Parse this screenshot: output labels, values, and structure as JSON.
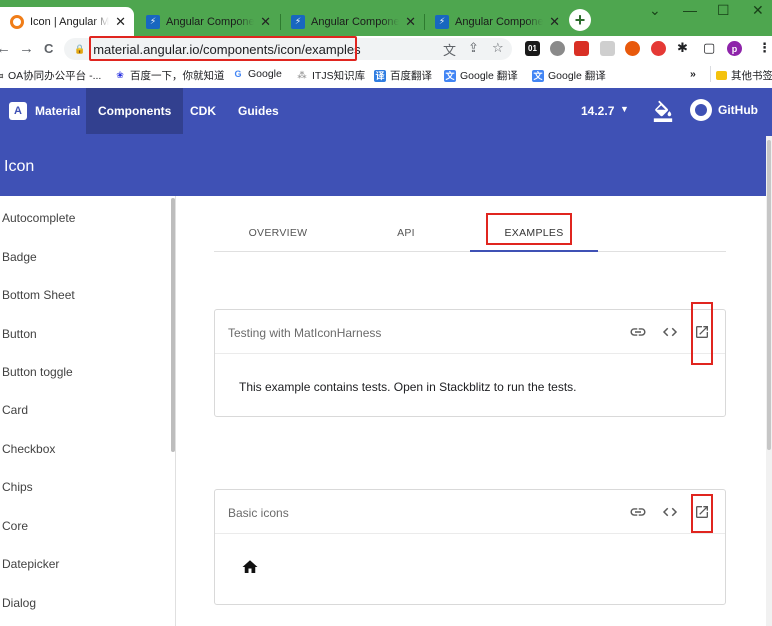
{
  "browser": {
    "tabs": [
      {
        "title": "Icon | Angular Material",
        "favicon": "angular-material-icon",
        "active": true
      },
      {
        "title": "Angular Components",
        "favicon": "stackblitz-icon",
        "active": false
      },
      {
        "title": "Angular Components",
        "favicon": "stackblitz-icon",
        "active": false
      },
      {
        "title": "Angular Components",
        "favicon": "stackblitz-icon",
        "active": false
      }
    ],
    "tab_close_glyph": "✕",
    "new_tab_glyph": "+",
    "window_controls": [
      "⌄",
      "—",
      "☐",
      "✕"
    ],
    "nav": {
      "back": "←",
      "forward": "→",
      "reload": "C"
    },
    "url": "material.angular.io/components/icon/examples",
    "omnibox_icons": [
      "translate-icon",
      "share-icon",
      "star-icon"
    ],
    "extension_badges": [
      "01"
    ],
    "profile_initial": "p",
    "bookmarks": [
      {
        "label": "OA协同办公平台 -..."
      },
      {
        "label": "百度一下，你就知道"
      },
      {
        "label": "Google"
      },
      {
        "label": "ITJS知识库"
      },
      {
        "label": "百度翻译"
      },
      {
        "label": "Google 翻译"
      },
      {
        "label": "Google 翻译"
      }
    ],
    "bookmarks_overflow": "»",
    "other_bookmarks": "其他书签"
  },
  "site": {
    "brand": "Material",
    "nav": [
      "Components",
      "CDK",
      "Guides"
    ],
    "version": "14.2.7",
    "version_caret": "▼",
    "github": "GitHub",
    "page_title": "Icon"
  },
  "sidebar": {
    "items": [
      "Autocomplete",
      "Badge",
      "Bottom Sheet",
      "Button",
      "Button toggle",
      "Card",
      "Checkbox",
      "Chips",
      "Core",
      "Datepicker",
      "Dialog"
    ]
  },
  "content_tabs": [
    "OVERVIEW",
    "API",
    "EXAMPLES"
  ],
  "active_tab": "EXAMPLES",
  "examples": [
    {
      "title": "Testing with MatIconHarness",
      "body": "This example contains tests. Open in Stackblitz to run the tests."
    },
    {
      "title": "Basic icons",
      "body_icon": "home-icon"
    }
  ],
  "colors": {
    "tab_strip": "#4ea64f",
    "material_primary": "#3f51b5",
    "highlight_annotation": "#e0251f"
  }
}
